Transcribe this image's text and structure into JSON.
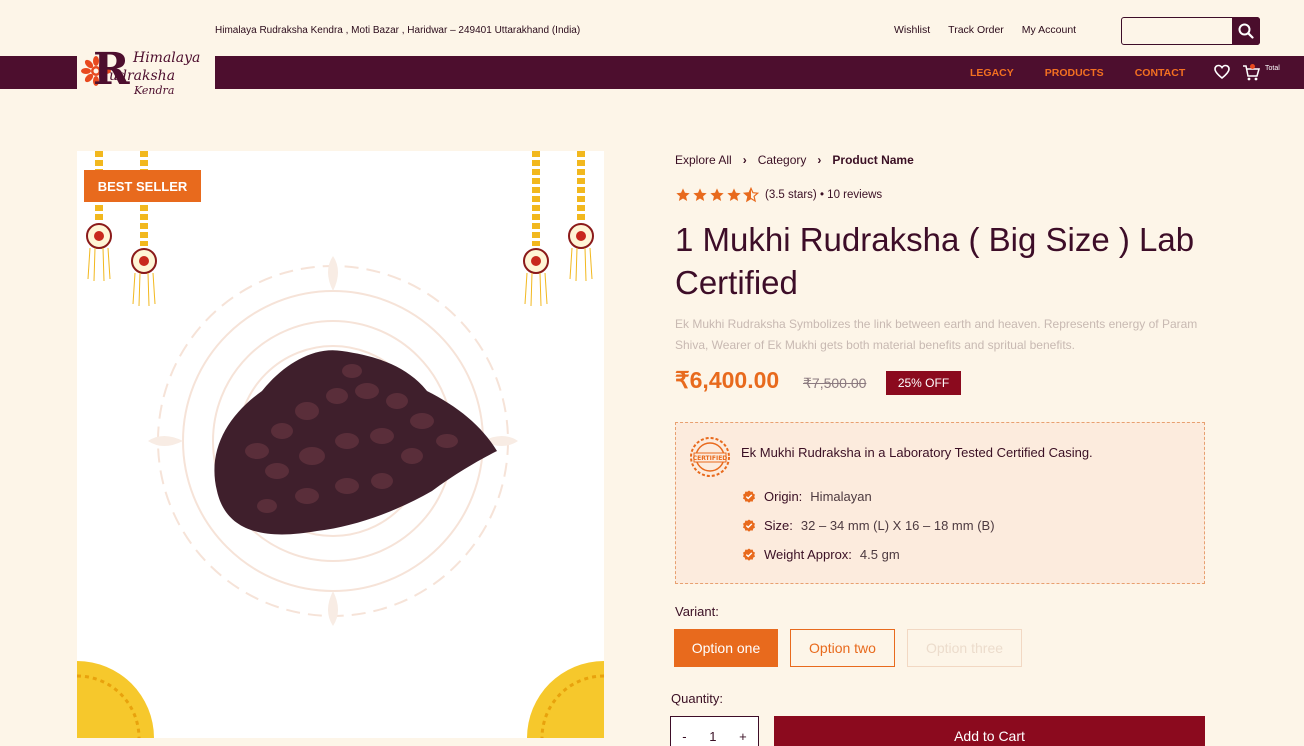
{
  "header": {
    "address": "Himalaya Rudraksha Kendra , Moti Bazar , Haridwar – 249401 Uttarakhand (India)",
    "links": [
      "Wishlist",
      "Track Order",
      "My Account"
    ],
    "search_placeholder": ""
  },
  "logo": {
    "line1": "Himalaya",
    "big_letter": "R",
    "line2": "udraksha",
    "line3": "Kendra"
  },
  "nav": {
    "links": [
      "LEGACY",
      "PRODUCTS",
      "CONTACT"
    ],
    "cart_label": "Total"
  },
  "product_image": {
    "badge": "BEST SELLER"
  },
  "breadcrumb": [
    "Explore All",
    "Category",
    "Product Name"
  ],
  "rating": {
    "text": "(3.5 stars) • 10 reviews",
    "stars_shown": 4.5,
    "max": 5
  },
  "product": {
    "title": "1 Mukhi Rudraksha ( Big Size ) Lab Certified",
    "description": "Ek Mukhi Rudraksha Symbolizes the link between earth and heaven. Represents energy of Param Shiva, Wearer of Ek Mukhi gets both material benefits and spritual benefits.",
    "price": "₹6,400.00",
    "old_price": "₹7,500.00",
    "discount": "25% OFF"
  },
  "certificate": {
    "title": "Ek Mukhi Rudraksha in a Laboratory Tested Certified Casing.",
    "features": [
      {
        "key": "Origin:",
        "value": "Himalayan"
      },
      {
        "key": "Size:",
        "value": "32 – 34 mm (L) X 16 – 18 mm (B)"
      },
      {
        "key": "Weight Approx:",
        "value": "4.5 gm"
      }
    ]
  },
  "variant": {
    "label": "Variant:",
    "options": [
      "Option one",
      "Option two",
      "Option three"
    ],
    "selected": "Option one"
  },
  "quantity": {
    "label": "Quantity:",
    "minus": "-",
    "value": "1",
    "plus": "+"
  },
  "add_to_cart": "Add to Cart",
  "colors": {
    "background": "#fdf5e8",
    "maroon": "#4d0e2e",
    "accent_orange": "#e86a1d",
    "button_red": "#8b0a1e"
  }
}
